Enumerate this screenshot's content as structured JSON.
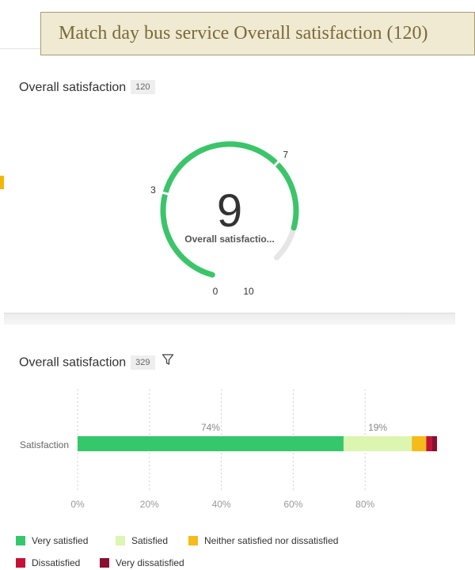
{
  "banner": {
    "title": "Match day bus  service Overall satisfaction (120)"
  },
  "gauge_card": {
    "title": "Overall satisfaction",
    "count": "120",
    "value": "9",
    "label": "Overall satisfactio...",
    "ticks": [
      {
        "label": "0",
        "value": 0
      },
      {
        "label": "3",
        "value": 3
      },
      {
        "label": "7",
        "value": 7
      },
      {
        "label": "10",
        "value": 10
      }
    ],
    "colors": {
      "fill": "#3cc46a",
      "track": "#e6e6e6"
    }
  },
  "bar_card": {
    "title": "Overall satisfaction",
    "count": "329",
    "filter_icon": "filter-icon"
  },
  "chart_data": {
    "type": "bar",
    "orientation": "horizontal",
    "stacked": true,
    "categories": [
      "Satisfaction"
    ],
    "series": [
      {
        "name": "Very satisfied",
        "values": [
          74
        ],
        "color": "#35c76c",
        "label": "74%"
      },
      {
        "name": "Satisfied",
        "values": [
          19
        ],
        "color": "#dcf5b0",
        "label": "19%"
      },
      {
        "name": "Neither satisfied nor dissatisfied",
        "values": [
          4
        ],
        "color": "#f4bb1a"
      },
      {
        "name": "Dissatisfied",
        "values": [
          1.5
        ],
        "color": "#c41236"
      },
      {
        "name": "Very dissatisfied",
        "values": [
          1.5
        ],
        "color": "#8a0f30"
      }
    ],
    "x_ticks": [
      "0%",
      "20%",
      "40%",
      "60%",
      "80%"
    ],
    "xlim": [
      0,
      100
    ],
    "grid": "vertical dotted",
    "legend_position": "bottom"
  }
}
